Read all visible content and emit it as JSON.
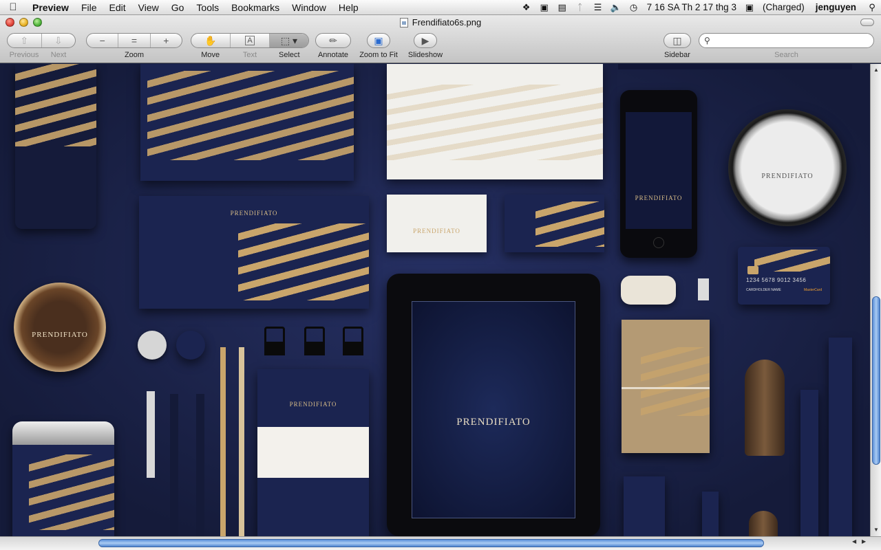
{
  "menubar": {
    "app_name": "Preview",
    "items": [
      "File",
      "Edit",
      "View",
      "Go",
      "Tools",
      "Bookmarks",
      "Window",
      "Help"
    ],
    "clock": "7 16 SA Th 2 17 thg 3",
    "battery": "(Charged)",
    "user": "jenguyen"
  },
  "window": {
    "title": "Frendifiato6s.png"
  },
  "toolbar": {
    "previous_label": "Previous",
    "next_label": "Next",
    "zoom_label": "Zoom",
    "move_label": "Move",
    "text_label": "Text",
    "select_label": "Select",
    "annotate_label": "Annotate",
    "zoom_to_fit_label": "Zoom to Fit",
    "slideshow_label": "Slideshow",
    "sidebar_label": "Sidebar",
    "search_label": "Search",
    "search_value": ""
  },
  "image": {
    "brand": "PRENDIFIATO",
    "card_number": "1234 5678 9012 3456",
    "card_holder": "CARDHOLDER NAME",
    "card_network": "MasterCard"
  },
  "colors": {
    "background_navy": "#1b2450",
    "accent_gold": "#c9a56b",
    "scroll_thumb": "#6a9ee4"
  }
}
